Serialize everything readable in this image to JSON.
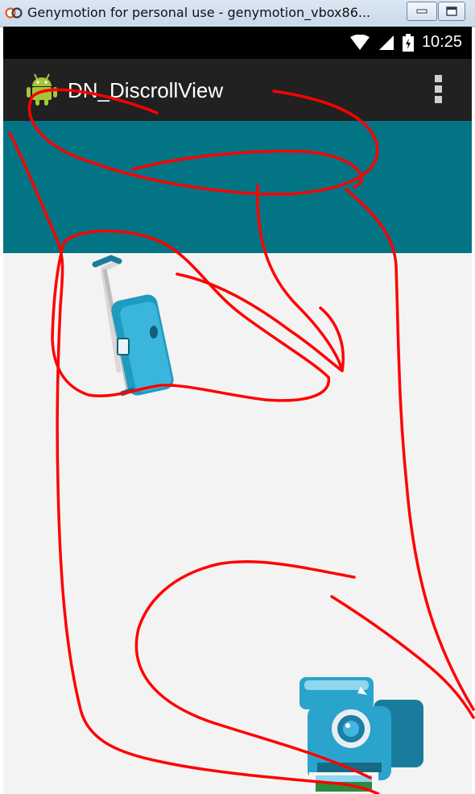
{
  "window": {
    "title": "Genymotion for personal use - genymotion_vbox86...",
    "minimize_icon": "minimize-icon",
    "maximize_icon": "maximize-icon"
  },
  "status_bar": {
    "time": "10:25",
    "icons": [
      "wifi-icon",
      "signal-icon",
      "battery-icon"
    ]
  },
  "action_bar": {
    "title": "DN_DiscrollView",
    "app_icon": "android-icon",
    "overflow_icon": "overflow-menu-icon"
  },
  "content": {
    "images": [
      "luggage-icon",
      "camera-icon"
    ]
  },
  "colors": {
    "status_bar": "#000000",
    "action_bar": "#212121",
    "header": "#027484",
    "content_bg": "#f3f3f3",
    "annotation": "#ff0000"
  }
}
